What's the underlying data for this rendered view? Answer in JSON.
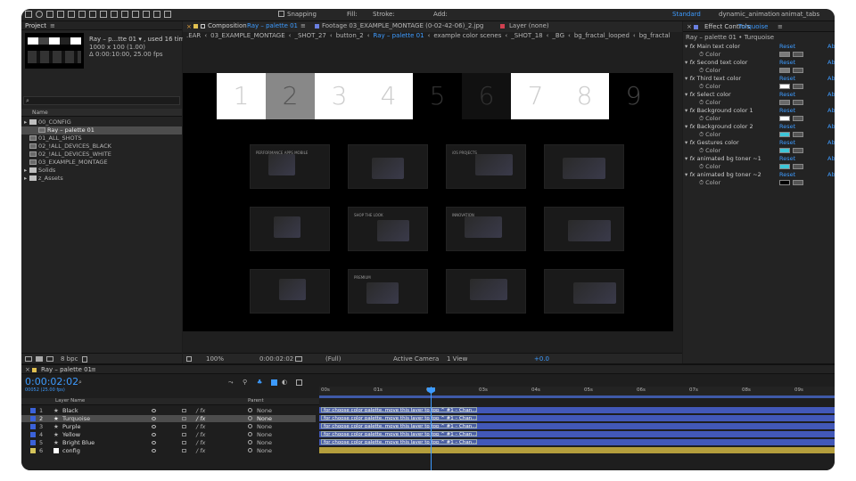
{
  "topbar": {
    "snapping_label": "Snapping",
    "fill_label": "Fill:",
    "stroke_label": "Stroke:",
    "add_label": "Add:",
    "workspace_standard": "Standard",
    "workspace_a": "dynamic_animation",
    "workspace_b": "animat_tabs"
  },
  "project": {
    "title": "Project",
    "comp_name": "Ray – p...tte 01 ▾ , used 16 times",
    "comp_size": "1000 x 100 (1.00)",
    "comp_dur": "Δ 0:00:10:00, 25.00 fps",
    "search_placeholder": "",
    "col_name": "Name",
    "items": [
      {
        "label": "00_CONFIG",
        "type": "folder",
        "indent": 0
      },
      {
        "label": "Ray – palette 01",
        "type": "comp",
        "indent": 1
      },
      {
        "label": "01_ALL_SHOTS",
        "type": "comp",
        "indent": 0
      },
      {
        "label": "02_!ALL_DEVICES_BLACK",
        "type": "comp",
        "indent": 0
      },
      {
        "label": "02_!ALL_DEVICES_WHITE",
        "type": "comp",
        "indent": 0
      },
      {
        "label": "03_EXAMPLE_MONTAGE",
        "type": "comp",
        "indent": 0
      },
      {
        "label": "Solids",
        "type": "folder",
        "indent": 0
      },
      {
        "label": "z_Assets",
        "type": "folder",
        "indent": 0
      }
    ],
    "bpc": "8 bpc"
  },
  "viewer": {
    "tab_comp_prefix": "Composition",
    "tab_comp_name": "Ray – palette 01",
    "tab_footage": "Footage 03_EXAMPLE_MONTAGE (0-02-42-06)_2.jpg",
    "tab_layer": "Layer (none)",
    "breadcrumbs": [
      ".EAR",
      "03_EXAMPLE_MONTAGE",
      "_SHOT_27",
      "button_2",
      "Ray – palette 01",
      "example color scenes",
      "_SHOT_18",
      "_BG",
      "bg_fractal_looped",
      "bg_fractal"
    ],
    "numbers": [
      "1",
      "2",
      "3",
      "4",
      "5",
      "6",
      "7",
      "8",
      "9"
    ],
    "thumb_captions": [
      "PERFORMANCE APPS MOBILE",
      "",
      "iOS PROJECTS",
      "",
      "",
      "SHOP THE LOOK",
      "INNOVATION",
      "",
      "",
      "PREMIUM",
      "",
      ""
    ],
    "zoom": "100%",
    "timecode": "0:00:02:02",
    "resolution": "(Full)",
    "camera": "Active Camera",
    "views": "1 View",
    "exposure": "+0.0"
  },
  "effects": {
    "title": "Effect Controls",
    "layer_name": "Turquoise",
    "breadcrumb": "Ray – palette 01 • Turquoise",
    "reset_label": "Reset",
    "about_label": "Ab",
    "color_label": "Color",
    "items": [
      {
        "name": "Main text color",
        "color": "#7a7a7a"
      },
      {
        "name": "Second text color",
        "color": "#7a7a7a"
      },
      {
        "name": "Third text color",
        "color": "#ffffff"
      },
      {
        "name": "Select color",
        "color": "#6a6a6a"
      },
      {
        "name": "Background color 1",
        "color": "#ffffff"
      },
      {
        "name": "Background color 2",
        "color": "#3ec6d8"
      },
      {
        "name": "Gestures color",
        "color": "#3ec6d8"
      },
      {
        "name": "animated bg toner ~1",
        "color": "#3ec6d8"
      },
      {
        "name": "animated bg toner ~2",
        "color": "#000000"
      }
    ]
  },
  "timeline": {
    "comp_tab": "Ray – palette 01",
    "timecode": "0:00:02:02",
    "frame_info": "00052 (25.00 fps)",
    "col_layer_name": "Layer Name",
    "col_parent": "Parent",
    "ruler": [
      "00s",
      "01s",
      "02s",
      "03s",
      "04s",
      "05s",
      "06s",
      "07s",
      "08s",
      "09s"
    ],
    "parent_value": "None",
    "layers": [
      {
        "num": "1",
        "name": "Black",
        "color": "#3b62d9",
        "star": true
      },
      {
        "num": "2",
        "name": "Turquoise",
        "color": "#3b62d9",
        "star": true
      },
      {
        "num": "3",
        "name": "Purple",
        "color": "#3b62d9",
        "star": true
      },
      {
        "num": "4",
        "name": "Yellow",
        "color": "#3b62d9",
        "star": true
      },
      {
        "num": "5",
        "name": "Bright Blue",
        "color": "#3b62d9",
        "star": true
      },
      {
        "num": "6",
        "name": "config",
        "color": "#d4c35a",
        "star": false
      }
    ],
    "bar_label": "for choose color palette, move this layer to top ^ #1 – Chan..."
  }
}
